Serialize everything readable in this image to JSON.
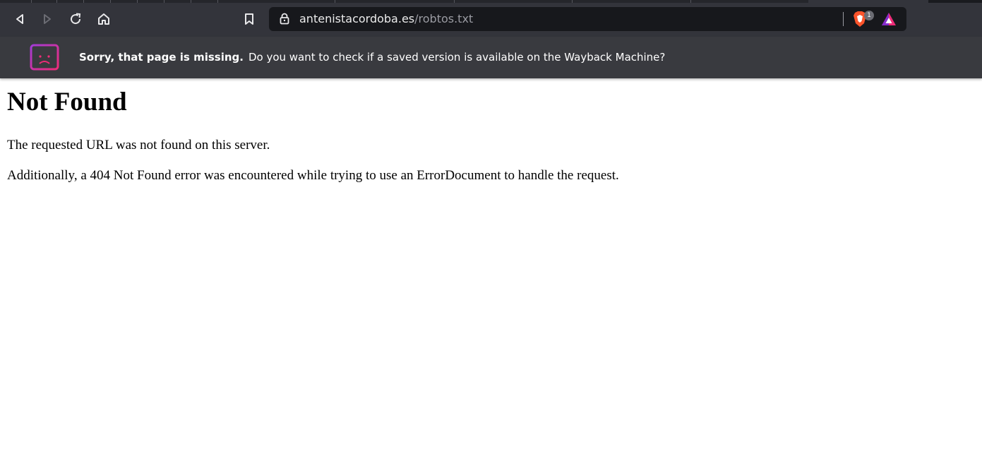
{
  "browser": {
    "url_domain": "antenistacordoba.es",
    "url_path": "/robtos.txt",
    "shield_badge_count": "1",
    "icons": [
      "back-icon",
      "forward-icon",
      "reload-icon",
      "home-icon",
      "bookmark-icon",
      "lock-icon",
      "brave-shield-icon",
      "brave-rewards-icon"
    ]
  },
  "notice": {
    "icon": "sad-browser-icon",
    "bold_text": "Sorry, that page is missing.",
    "text": "Do you want to check if a saved version is available on the Wayback Machine?"
  },
  "page": {
    "heading": "Not Found",
    "paragraph1": "The requested URL was not found on this server.",
    "paragraph2": "Additionally, a 404 Not Found error was encountered while trying to use an ErrorDocument to handle the request."
  },
  "colors": {
    "chrome_bg": "#33343b",
    "url_bar_bg": "#17181c",
    "notice_bg": "#393a3f",
    "brave_orange": "#fb542b",
    "accent_pink": "#ef2c78"
  }
}
